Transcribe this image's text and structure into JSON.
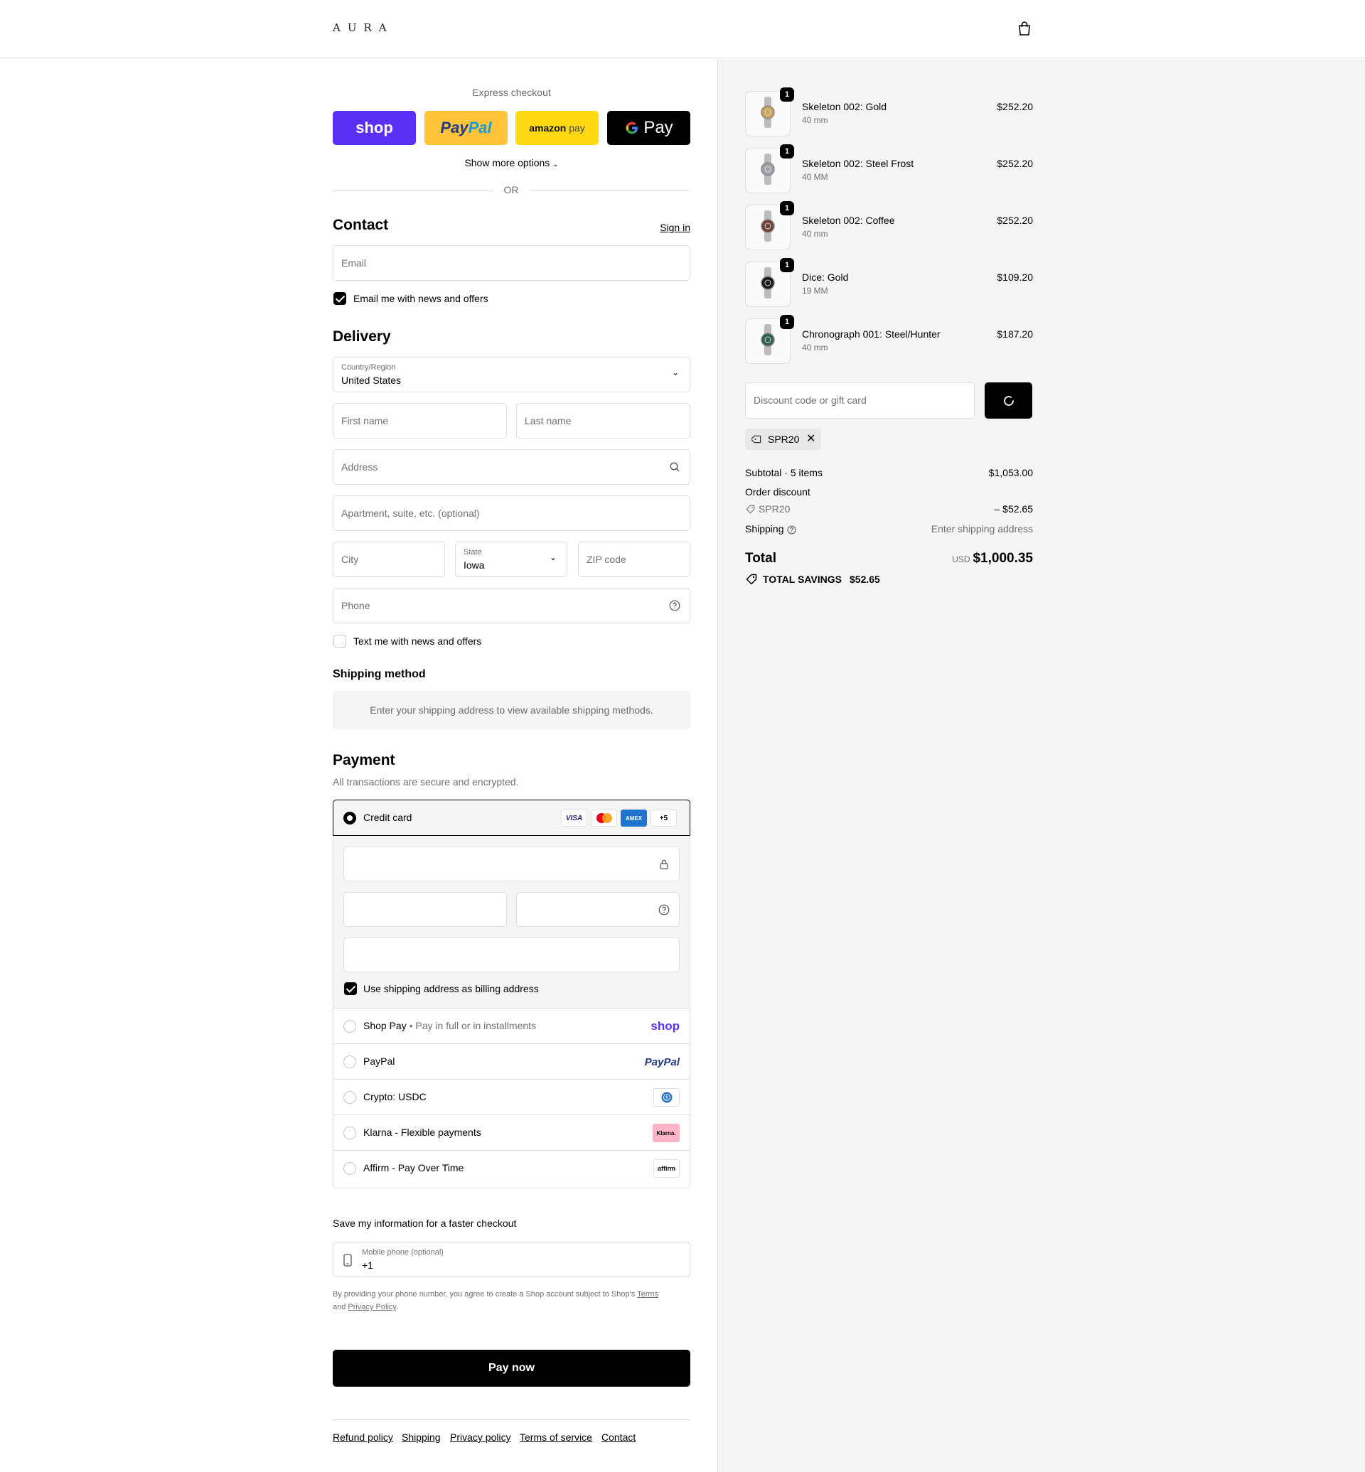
{
  "header": {
    "logo": "AURA"
  },
  "express": {
    "label": "Express checkout",
    "shop": "shop",
    "paypal_a": "Pay",
    "paypal_b": "Pal",
    "amazon_a": "amazon",
    "amazon_b": "pay",
    "gpay": "Pay",
    "show_more": "Show more options",
    "or": "OR"
  },
  "contact": {
    "title": "Contact",
    "sign_in": "Sign in",
    "email_placeholder": "Email",
    "news_label": "Email me with news and offers",
    "news_checked": true
  },
  "delivery": {
    "title": "Delivery",
    "country_label": "Country/Region",
    "country_value": "United States",
    "first_name": "First name",
    "last_name": "Last name",
    "address": "Address",
    "apartment": "Apartment, suite, etc. (optional)",
    "city": "City",
    "state_label": "State",
    "state_value": "Iowa",
    "zip": "ZIP code",
    "phone": "Phone",
    "text_label": "Text me with news and offers",
    "text_checked": false
  },
  "shipping_method": {
    "title": "Shipping method",
    "info": "Enter your shipping address to view available shipping methods."
  },
  "payment": {
    "title": "Payment",
    "subtitle": "All transactions are secure and encrypted.",
    "credit_card": "Credit card",
    "cards": [
      "VISA",
      "MC",
      "AMEX",
      "+5"
    ],
    "billing_label": "Use shipping address as billing address",
    "shop_pay": "Shop Pay",
    "shop_pay_sub": "Pay in full or in installments",
    "shop_logo": "shop",
    "paypal": "PayPal",
    "paypal_logo": "PayPal",
    "crypto": "Crypto: USDC",
    "klarna": "Klarna - Flexible payments",
    "klarna_logo": "Klarna.",
    "affirm": "Affirm - Pay Over Time",
    "affirm_logo": "affirm"
  },
  "save_info": {
    "title": "Save my information for a faster checkout",
    "phone_label": "Mobile phone (optional)",
    "phone_value": "+1",
    "legal_a": "By providing your phone number, you agree to create a Shop account subject to Shop's",
    "terms": "Terms",
    "legal_and": "and",
    "privacy": "Privacy Policy",
    "legal_end": "."
  },
  "pay_now": "Pay now",
  "footer": [
    "Refund policy",
    "Shipping",
    "Privacy policy",
    "Terms of service",
    "Contact"
  ],
  "order": {
    "items": [
      {
        "name": "Skeleton 002: Gold",
        "variant": "40 mm",
        "price": "$252.20",
        "qty": "1",
        "color": "#c9a25a"
      },
      {
        "name": "Skeleton 002: Steel Frost",
        "variant": "40 MM",
        "price": "$252.20",
        "qty": "1",
        "color": "#9aa0a6"
      },
      {
        "name": "Skeleton 002: Coffee",
        "variant": "40 mm",
        "price": "$252.20",
        "qty": "1",
        "color": "#6b4636"
      },
      {
        "name": "Dice: Gold",
        "variant": "19 MM",
        "price": "$109.20",
        "qty": "1",
        "color": "#1a1a1a"
      },
      {
        "name": "Chronograph 001: Steel/Hunter",
        "variant": "40 mm",
        "price": "$187.20",
        "qty": "1",
        "color": "#2f5d50"
      }
    ],
    "discount_placeholder": "Discount code or gift card",
    "applied_code": "SPR20",
    "subtotal_label": "Subtotal · 5 items",
    "subtotal": "$1,053.00",
    "order_discount": "Order discount",
    "discount_code": "SPR20",
    "discount_value": "– $52.65",
    "shipping_label": "Shipping",
    "shipping_value": "Enter shipping address",
    "total_label": "Total",
    "currency": "USD",
    "total": "$1,000.35",
    "savings_label": "TOTAL SAVINGS",
    "savings": "$52.65"
  }
}
